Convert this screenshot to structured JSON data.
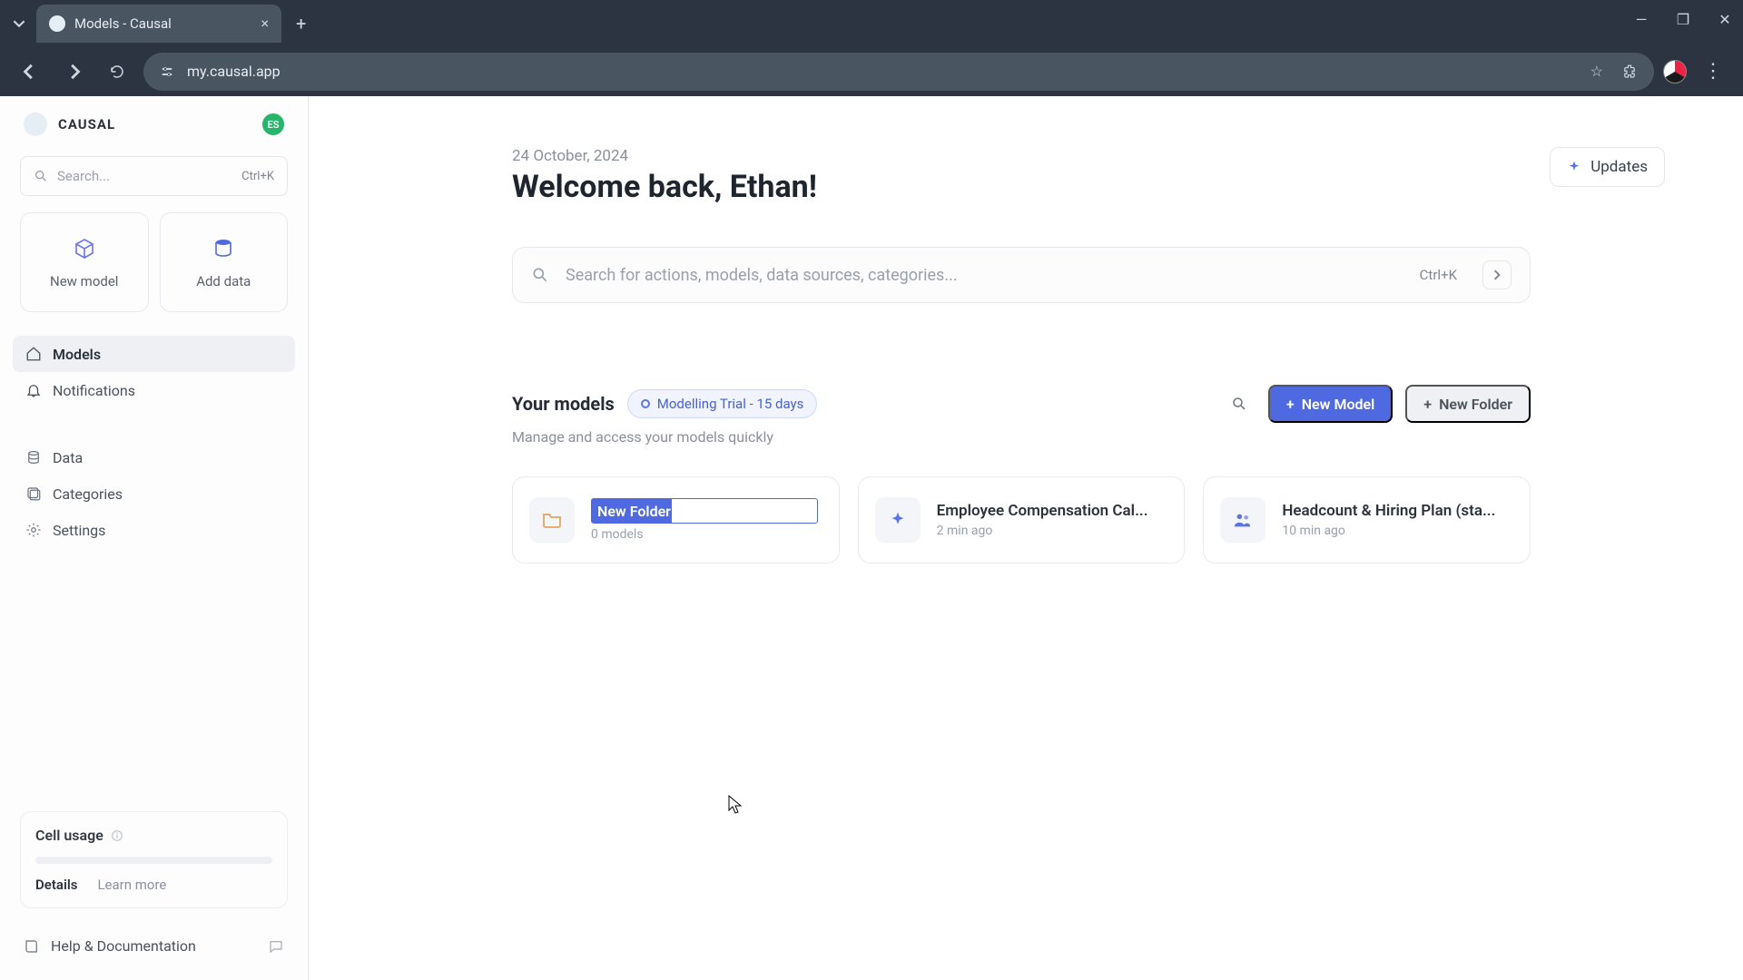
{
  "browser": {
    "tab_title": "Models - Causal",
    "url": "my.causal.app"
  },
  "sidebar": {
    "brand": "CAUSAL",
    "badge": "ES",
    "search_placeholder": "Search...",
    "search_kbd": "Ctrl+K",
    "quick": [
      {
        "label": "New model"
      },
      {
        "label": "Add data"
      }
    ],
    "nav_primary": [
      {
        "label": "Models",
        "active": true
      },
      {
        "label": "Notifications",
        "active": false
      }
    ],
    "nav_secondary": [
      {
        "label": "Data"
      },
      {
        "label": "Categories"
      },
      {
        "label": "Settings"
      }
    ],
    "usage": {
      "title": "Cell usage",
      "details": "Details",
      "learn": "Learn more"
    },
    "help": "Help & Documentation"
  },
  "main": {
    "date": "24 October, 2024",
    "welcome": "Welcome back, Ethan!",
    "updates": "Updates",
    "search_placeholder": "Search for actions, models, data sources, categories...",
    "search_kbd": "Ctrl+K",
    "section_title": "Your models",
    "trial": "Modelling Trial - 15 days",
    "section_sub": "Manage and access your models quickly",
    "btn_new_model": "New Model",
    "btn_new_folder": "New Folder",
    "cards": [
      {
        "type": "folder",
        "title": "New Folder",
        "sub": "0 models"
      },
      {
        "type": "model",
        "title": "Employee Compensation Cal...",
        "sub": "2 min ago"
      },
      {
        "type": "model",
        "title": "Headcount & Hiring Plan (sta...",
        "sub": "10 min ago"
      }
    ]
  }
}
